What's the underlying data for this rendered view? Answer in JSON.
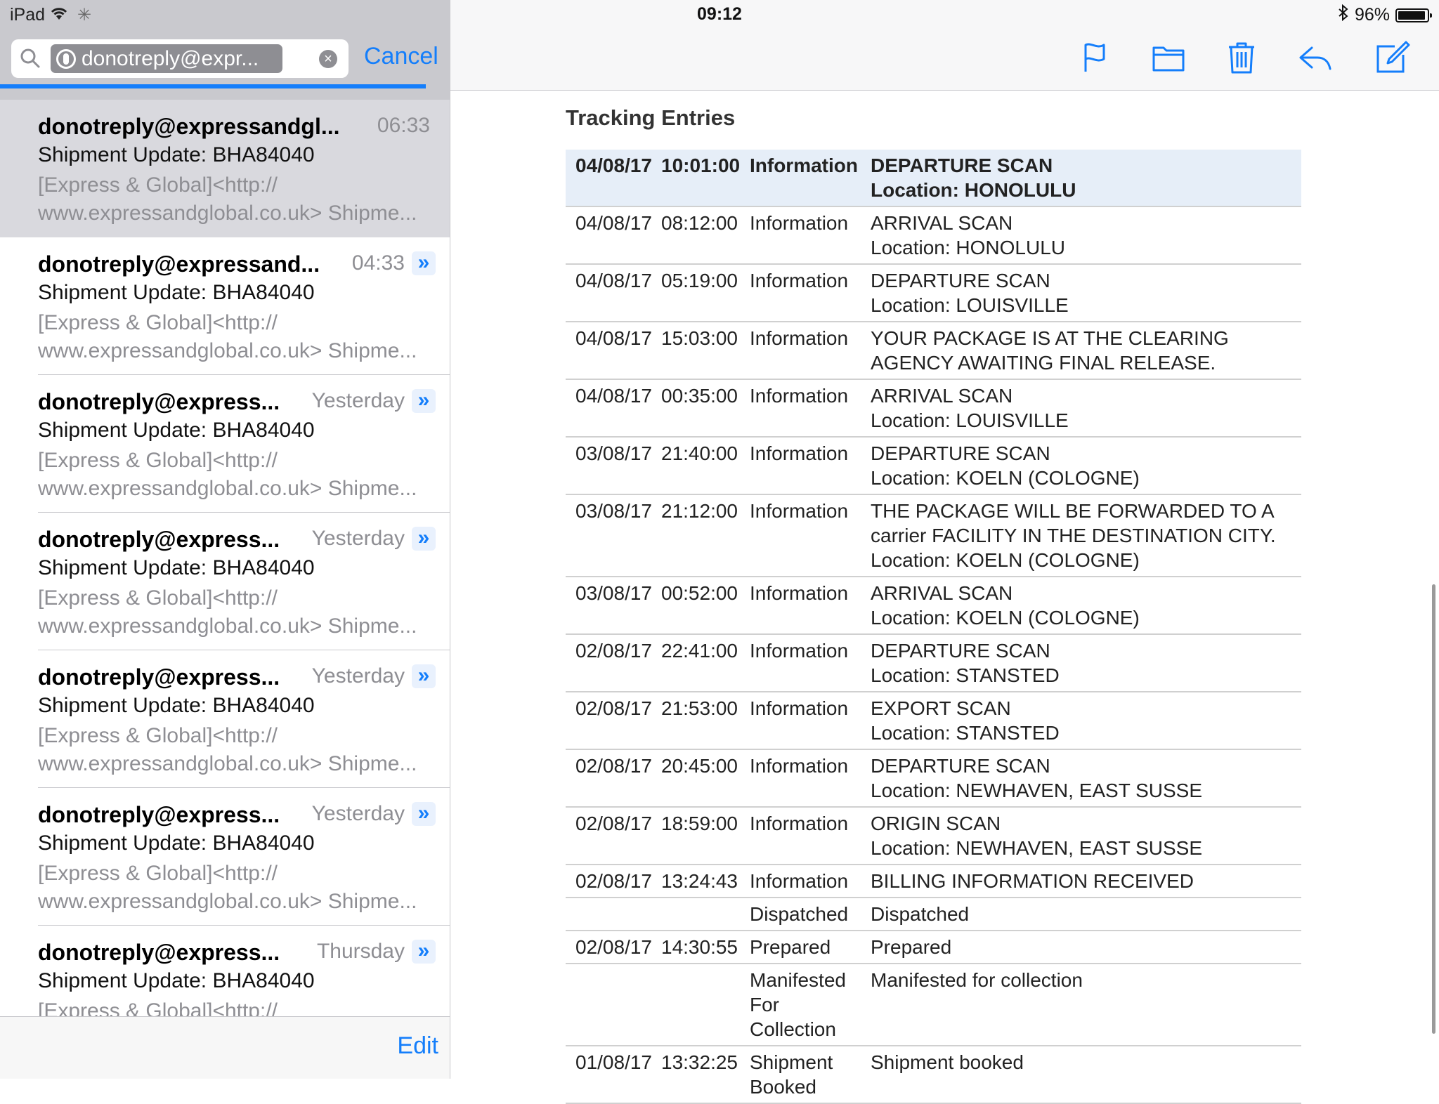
{
  "status_bar": {
    "device": "iPad",
    "time": "09:12",
    "battery": "96%",
    "battery_level": 0.96
  },
  "search": {
    "token": "donotreply@expr...",
    "cancel_label": "Cancel"
  },
  "mail_list": {
    "items": [
      {
        "sender": "donotreply@expressandgl...",
        "time": "06:33",
        "subject": "Shipment Update: BHA84040",
        "preview1": "[Express & Global]<http://",
        "preview2": "www.expressandglobal.co.uk> Shipme..."
      },
      {
        "sender": "donotreply@expressand...",
        "time": "04:33",
        "subject": "Shipment Update: BHA84040",
        "preview1": "[Express & Global]<http://",
        "preview2": "www.expressandglobal.co.uk> Shipme..."
      },
      {
        "sender": "donotreply@express...",
        "time": "Yesterday",
        "subject": "Shipment Update: BHA84040",
        "preview1": "[Express & Global]<http://",
        "preview2": "www.expressandglobal.co.uk> Shipme..."
      },
      {
        "sender": "donotreply@express...",
        "time": "Yesterday",
        "subject": "Shipment Update: BHA84040",
        "preview1": "[Express & Global]<http://",
        "preview2": "www.expressandglobal.co.uk> Shipme..."
      },
      {
        "sender": "donotreply@express...",
        "time": "Yesterday",
        "subject": "Shipment Update: BHA84040",
        "preview1": "[Express & Global]<http://",
        "preview2": "www.expressandglobal.co.uk> Shipme..."
      },
      {
        "sender": "donotreply@express...",
        "time": "Yesterday",
        "subject": "Shipment Update: BHA84040",
        "preview1": "[Express & Global]<http://",
        "preview2": "www.expressandglobal.co.uk> Shipme..."
      },
      {
        "sender": "donotreply@express...",
        "time": "Thursday",
        "subject": "Shipment Update: BHA84040",
        "preview1": "[Express & Global]<http://",
        "preview2": ""
      }
    ],
    "thread_icon": "»",
    "edit_label": "Edit"
  },
  "toolbar": {
    "icons": [
      "flag-icon",
      "folder-icon",
      "trash-icon",
      "reply-icon",
      "compose-icon"
    ],
    "accent_color": "#147efb"
  },
  "tracking": {
    "title": "Tracking Entries",
    "rows": [
      {
        "date": "04/08/17",
        "time": "10:01:00",
        "type": "Information",
        "desc": [
          "DEPARTURE SCAN",
          "Location: HONOLULU"
        ]
      },
      {
        "date": "04/08/17",
        "time": "08:12:00",
        "type": "Information",
        "desc": [
          "ARRIVAL SCAN",
          "Location: HONOLULU"
        ]
      },
      {
        "date": "04/08/17",
        "time": "05:19:00",
        "type": "Information",
        "desc": [
          "DEPARTURE SCAN",
          "Location: LOUISVILLE"
        ]
      },
      {
        "date": "04/08/17",
        "time": "15:03:00",
        "type": "Information",
        "desc": [
          "YOUR PACKAGE IS AT THE CLEARING",
          "AGENCY AWAITING FINAL RELEASE."
        ]
      },
      {
        "date": "04/08/17",
        "time": "00:35:00",
        "type": "Information",
        "desc": [
          "ARRIVAL SCAN",
          "Location: LOUISVILLE"
        ]
      },
      {
        "date": "03/08/17",
        "time": "21:40:00",
        "type": "Information",
        "desc": [
          "DEPARTURE SCAN",
          "Location: KOELN (COLOGNE)"
        ]
      },
      {
        "date": "03/08/17",
        "time": "21:12:00",
        "type": "Information",
        "desc": [
          "THE PACKAGE WILL BE FORWARDED TO A",
          "carrier FACILITY IN THE DESTINATION CITY.",
          "Location: KOELN (COLOGNE)"
        ]
      },
      {
        "date": "03/08/17",
        "time": "00:52:00",
        "type": "Information",
        "desc": [
          "ARRIVAL SCAN",
          "Location: KOELN (COLOGNE)"
        ]
      },
      {
        "date": "02/08/17",
        "time": "22:41:00",
        "type": "Information",
        "desc": [
          "DEPARTURE SCAN",
          "Location: STANSTED"
        ]
      },
      {
        "date": "02/08/17",
        "time": "21:53:00",
        "type": "Information",
        "desc": [
          "EXPORT SCAN",
          "Location: STANSTED"
        ]
      },
      {
        "date": "02/08/17",
        "time": "20:45:00",
        "type": "Information",
        "desc": [
          "DEPARTURE SCAN",
          "Location: NEWHAVEN, EAST SUSSE"
        ]
      },
      {
        "date": "02/08/17",
        "time": "18:59:00",
        "type": "Information",
        "desc": [
          "ORIGIN SCAN",
          "Location: NEWHAVEN, EAST SUSSE"
        ]
      },
      {
        "date": "02/08/17",
        "time": "13:24:43",
        "type": "Information",
        "desc": [
          "BILLING INFORMATION RECEIVED"
        ]
      },
      {
        "date": "",
        "time": "",
        "type": "Dispatched",
        "desc": [
          "Dispatched"
        ]
      },
      {
        "date": "02/08/17",
        "time": "14:30:55",
        "type": "Prepared",
        "desc": [
          "Prepared"
        ]
      },
      {
        "date": "",
        "time": "",
        "type": "Manifested For Collection",
        "desc": [
          "Manifested for collection"
        ]
      },
      {
        "date": "01/08/17",
        "time": "13:32:25",
        "type": "Shipment Booked",
        "desc": [
          "Shipment booked"
        ]
      }
    ]
  }
}
